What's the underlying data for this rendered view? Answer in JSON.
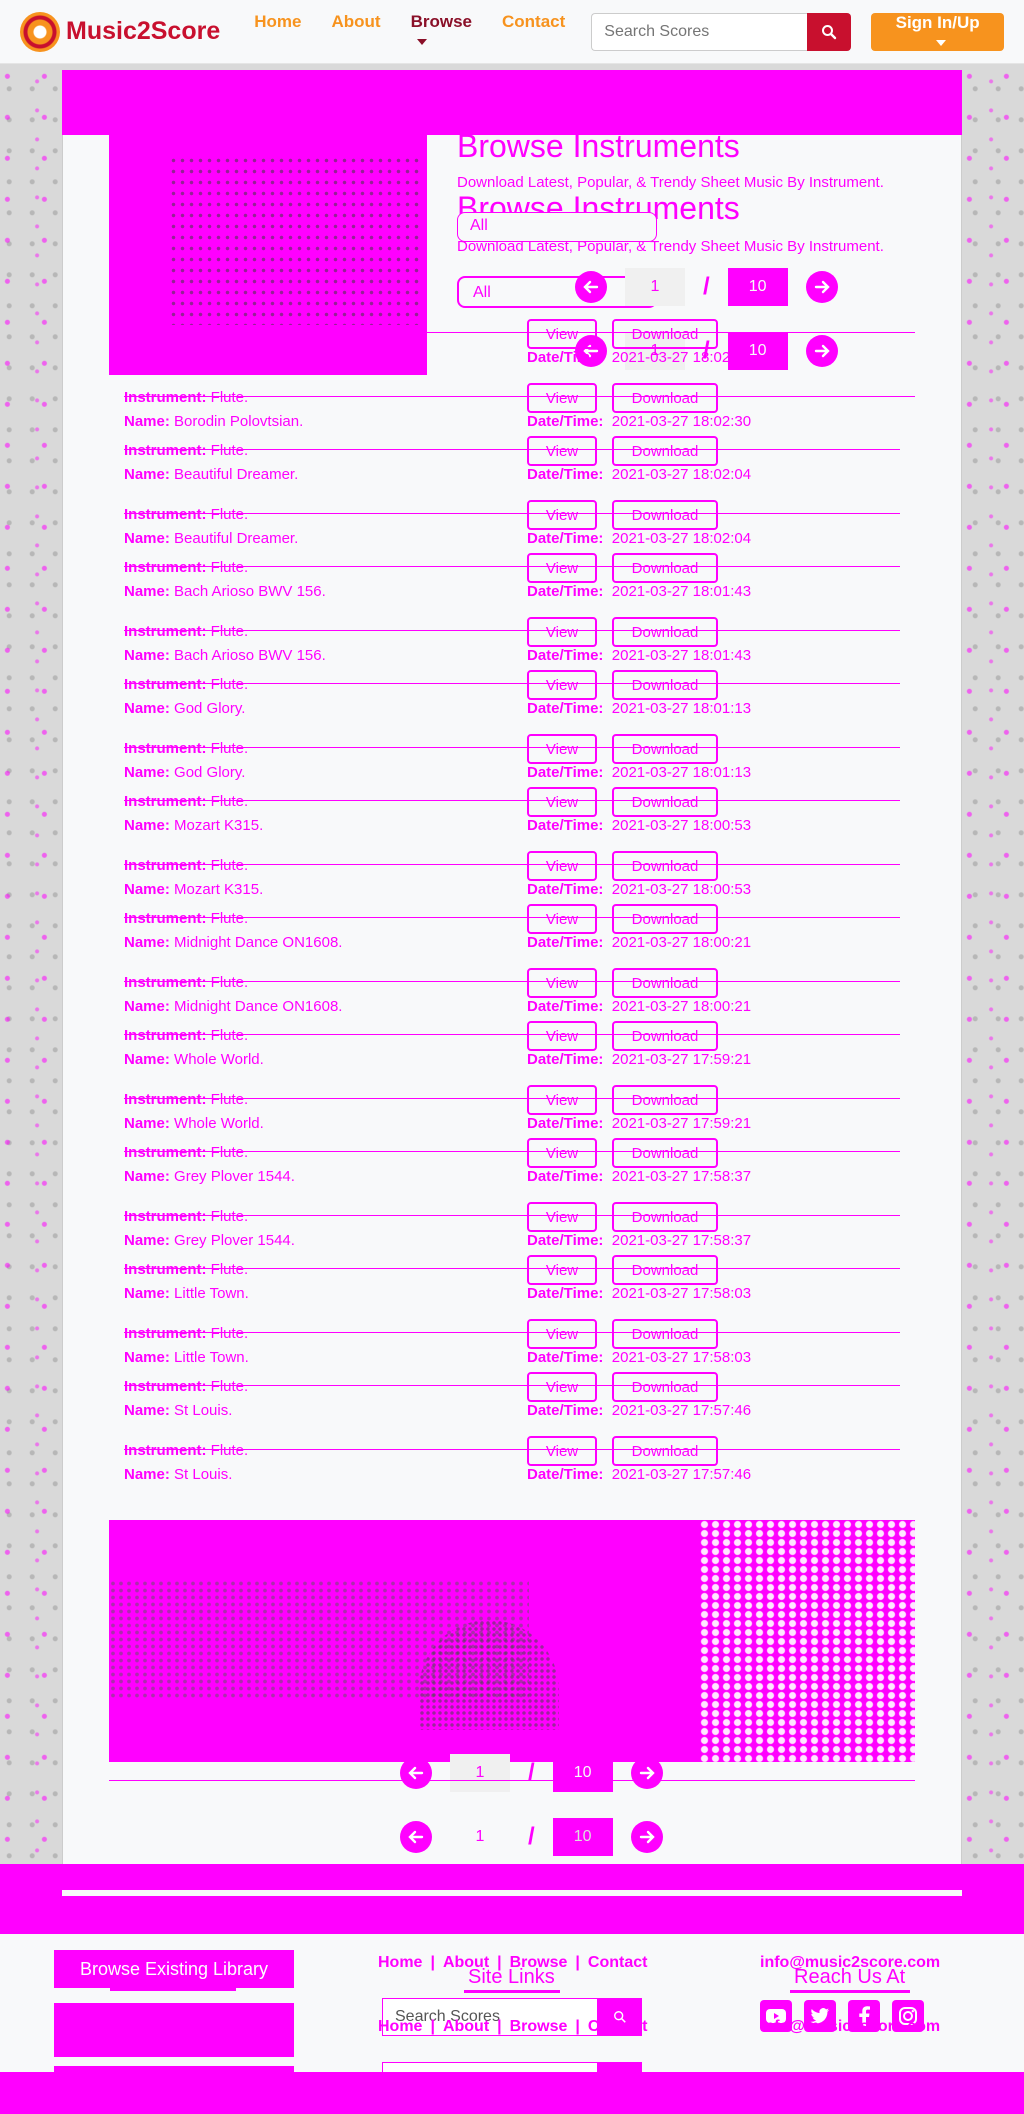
{
  "navbar": {
    "brand": "Music2Score",
    "links": [
      {
        "label": "Home"
      },
      {
        "label": "About"
      },
      {
        "label": "Browse"
      },
      {
        "label": "Contact"
      }
    ],
    "search_placeholder": "Search Scores",
    "signin_label": "Sign In/Up"
  },
  "header": {
    "title": "Browse Instruments",
    "subtitle": "Download Latest, Popular, & Trendy Sheet Music By Instrument.",
    "filter_value": "All"
  },
  "pager": {
    "current": "1",
    "slash": "/",
    "total": "10"
  },
  "labels": {
    "instrument": "Instrument:",
    "name": "Name:",
    "datetime": "Date/Time:",
    "view": "View",
    "download": "Download"
  },
  "scores": [
    {
      "instrument": "Flute.",
      "name": "Borodin Polovtsian.",
      "datetime": "2021-03-27 18:02:30"
    },
    {
      "instrument": "Flute.",
      "name": "Beautiful Dreamer.",
      "datetime": "2021-03-27 18:02:04"
    },
    {
      "instrument": "Flute.",
      "name": "Bach Arioso BWV 156.",
      "datetime": "2021-03-27 18:01:43"
    },
    {
      "instrument": "Flute.",
      "name": "God Glory.",
      "datetime": "2021-03-27 18:01:13"
    },
    {
      "instrument": "Flute.",
      "name": "Mozart K315.",
      "datetime": "2021-03-27 18:00:53"
    },
    {
      "instrument": "Flute.",
      "name": "Midnight Dance ON1608.",
      "datetime": "2021-03-27 18:00:21"
    },
    {
      "instrument": "Flute.",
      "name": "Whole World.",
      "datetime": "2021-03-27 17:59:21"
    },
    {
      "instrument": "Flute.",
      "name": "Grey Plover 1544.",
      "datetime": "2021-03-27 17:58:37"
    },
    {
      "instrument": "Flute.",
      "name": "Little Town.",
      "datetime": "2021-03-27 17:58:03"
    },
    {
      "instrument": "Flute.",
      "name": "St Louis.",
      "datetime": "2021-03-27 17:57:46"
    }
  ],
  "footer": {
    "buttons": [
      "Browse Existing Library"
    ],
    "links": [
      "Home",
      "|",
      "About",
      "|",
      "Browse",
      "|",
      "Contact"
    ],
    "site_links_title": "Site Links",
    "search_placeholder": "Search Scores",
    "reach_title": "Reach Us At",
    "email": "info@music2score.com"
  },
  "colors": {
    "brand_red": "#c8102e",
    "brand_orange": "#f7931e",
    "accent_magenta": "#ff00ff"
  }
}
